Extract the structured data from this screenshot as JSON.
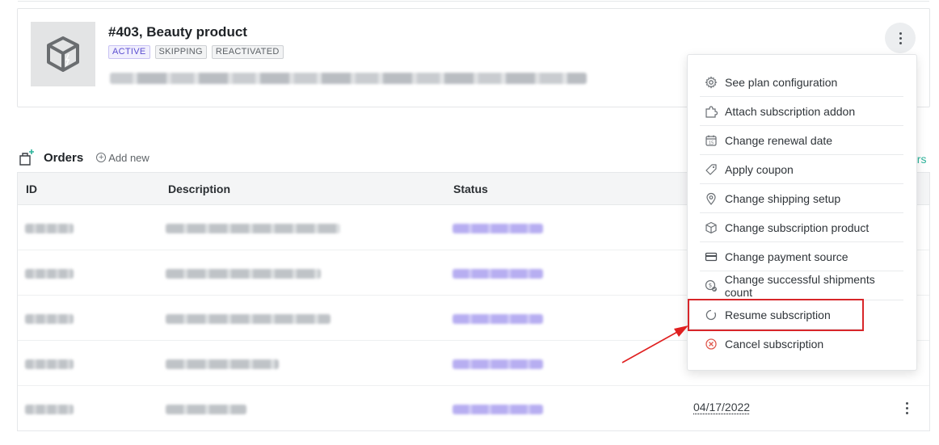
{
  "subscription": {
    "title": "#403, Beauty product",
    "badges": [
      "ACTIVE",
      "SKIPPING",
      "REACTIVATED"
    ]
  },
  "orders": {
    "title": "Orders",
    "add_new": "Add new",
    "link_fragment": "ers",
    "columns": [
      "ID",
      "Description",
      "Status"
    ],
    "rows": [
      {
        "date": ""
      },
      {
        "date": ""
      },
      {
        "date": ""
      },
      {
        "date": ""
      },
      {
        "date": "04/17/2022"
      }
    ]
  },
  "menu": {
    "items": [
      {
        "label": "See plan configuration",
        "icon": "gear-icon"
      },
      {
        "label": "Attach subscription addon",
        "icon": "puzzle-icon"
      },
      {
        "label": "Change renewal date",
        "icon": "calendar-icon"
      },
      {
        "label": "Apply coupon",
        "icon": "tag-icon"
      },
      {
        "label": "Change shipping setup",
        "icon": "map-pin-icon"
      },
      {
        "label": "Change subscription product",
        "icon": "box-icon"
      },
      {
        "label": "Change payment source",
        "icon": "credit-card-icon"
      },
      {
        "label": "Change successful shipments count",
        "icon": "coin-check-icon"
      },
      {
        "label": "Resume subscription",
        "icon": "resume-icon"
      },
      {
        "label": "Cancel subscription",
        "icon": "cancel-icon"
      }
    ]
  },
  "colors": {
    "accent": "#5b4ed1",
    "link": "#2bb39a",
    "highlight": "#d8262a",
    "cancel": "#e05a4f"
  }
}
